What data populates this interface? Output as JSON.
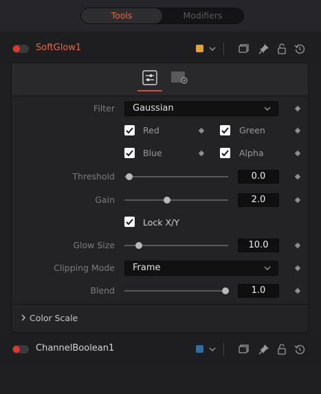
{
  "tabs": {
    "tools": "Tools",
    "modifiers": "Modifiers"
  },
  "nodes": [
    {
      "name": "SoftGlow1",
      "swatch_color": "#e8a025",
      "name_color": "#e96a42"
    },
    {
      "name": "ChannelBoolean1",
      "swatch_color": "#2a6fa8",
      "name_color": "#d6d6d6"
    }
  ],
  "controls": {
    "filter": {
      "label": "Filter",
      "value": "Gaussian"
    },
    "red": {
      "label": "Red",
      "checked": true
    },
    "green": {
      "label": "Green",
      "checked": true
    },
    "blue": {
      "label": "Blue",
      "checked": true
    },
    "alpha": {
      "label": "Alpha",
      "checked": true
    },
    "threshold": {
      "label": "Threshold",
      "value": "0.0"
    },
    "gain": {
      "label": "Gain",
      "value": "2.0"
    },
    "lock_xy": {
      "label": "Lock X/Y",
      "checked": true
    },
    "glow_size": {
      "label": "Glow Size",
      "value": "10.0"
    },
    "clipping_mode": {
      "label": "Clipping Mode",
      "value": "Frame"
    },
    "blend": {
      "label": "Blend",
      "value": "1.0"
    }
  },
  "color_scale": {
    "label": "Color Scale"
  },
  "accent_color": "#e0483a",
  "icons": {
    "header": [
      "toggle-switch",
      "color-swatch",
      "chevron-down-icon",
      "window-icon",
      "pin-icon",
      "lock-icon",
      "reset-icon"
    ],
    "tabs": [
      "controls-tab-icon",
      "settings-tab-icon"
    ]
  }
}
